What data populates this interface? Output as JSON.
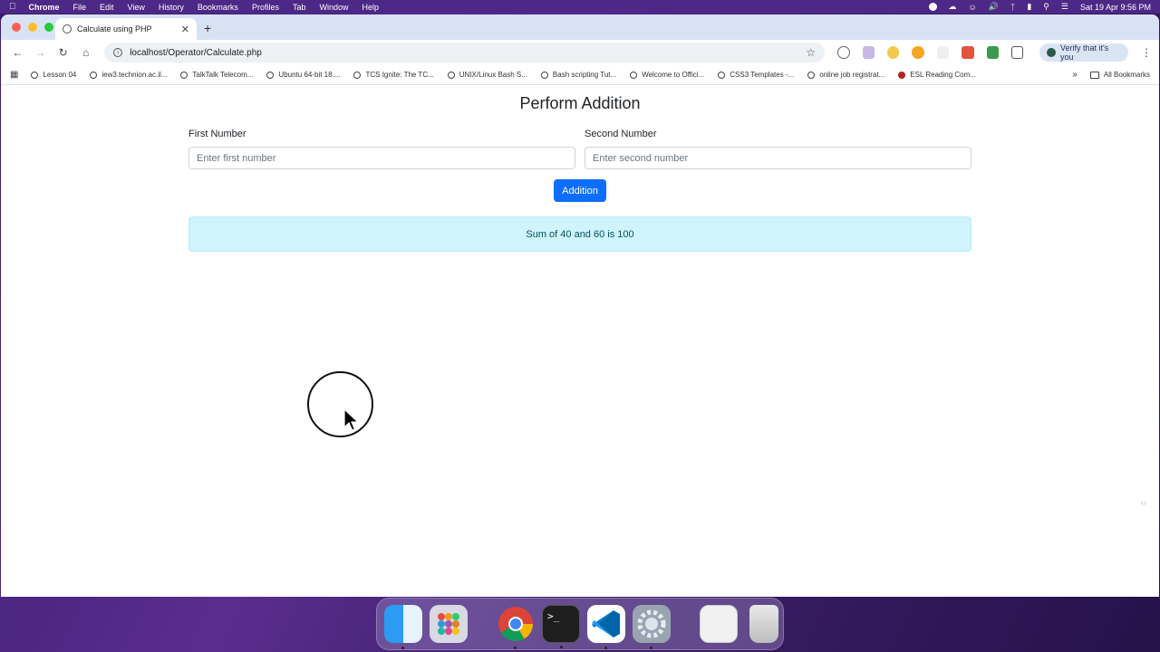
{
  "menubar": {
    "items": [
      "Chrome",
      "File",
      "Edit",
      "View",
      "History",
      "Bookmarks",
      "Profiles",
      "Tab",
      "Window",
      "Help"
    ],
    "datetime": "Sat 19 Apr  9:56 PM"
  },
  "browser": {
    "tab_title": "Calculate using PHP",
    "url": "localhost/Operator/Calculate.php",
    "verify_label": "Verify that it's you",
    "bookmarks": [
      "Lesson 04",
      "iew3.technion.ac.il...",
      "TalkTalk Telecom...",
      "Ubuntu 64-bit 18....",
      "TCS Ignite: The TC...",
      "UNIX/Linux Bash S...",
      "Bash scripting Tut...",
      "Welcome to Offici...",
      "CSS3 Templates -...",
      "online job registrat...",
      "ESL Reading Com..."
    ],
    "all_bookmarks": "All Bookmarks"
  },
  "form": {
    "title": "Perform Addition",
    "first_label": "First Number",
    "first_placeholder": "Enter first number",
    "second_label": "Second Number",
    "second_placeholder": "Enter second number",
    "button_label": "Addition",
    "result": "Sum of 40 and 60 is 100"
  },
  "colors": {
    "primary": "#0d6efd",
    "alert_bg": "#cff4fc",
    "alert_text": "#055160"
  },
  "dock": [
    "finder-icon",
    "launchpad-icon",
    "chrome-icon",
    "terminal-icon",
    "vscode-icon",
    "system-settings-icon",
    "preview-window-icon",
    "trash-icon"
  ]
}
